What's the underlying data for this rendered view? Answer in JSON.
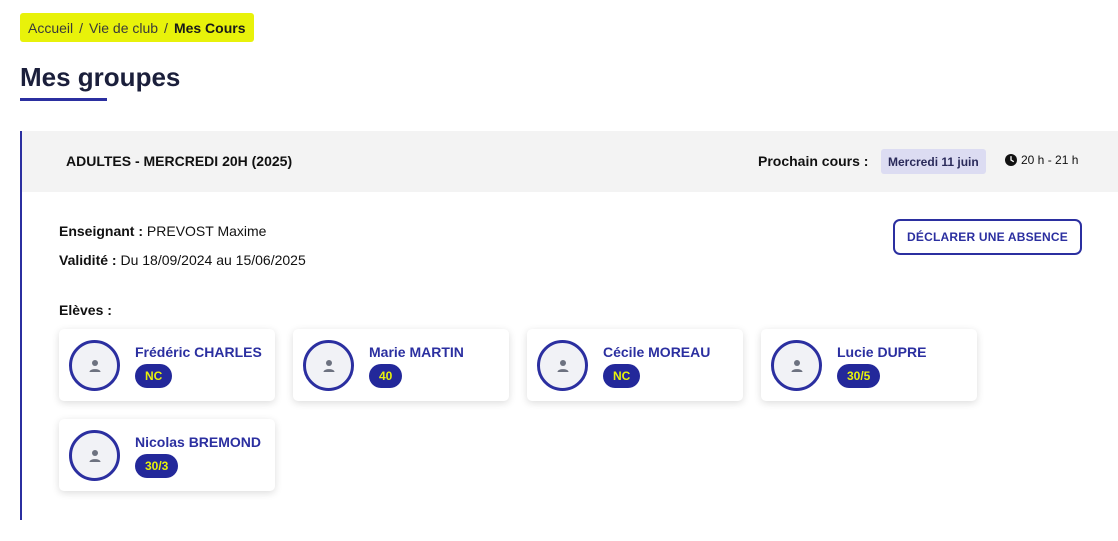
{
  "breadcrumb": {
    "items": [
      "Accueil",
      "Vie de club",
      "Mes Cours"
    ],
    "separator": "/"
  },
  "page": {
    "title": "Mes groupes"
  },
  "group": {
    "name": "ADULTES - MERCREDI 20H (2025)",
    "next_course_label": "Prochain cours :",
    "next_course_date": "Mercredi 11 juin",
    "next_course_time": "20 h - 21 h",
    "teacher_label": "Enseignant :",
    "teacher_value": " PREVOST Maxime",
    "validity_label": "Validité :",
    "validity_value": " Du 18/09/2024 au 15/06/2025",
    "absence_button": "DÉCLARER UNE ABSENCE",
    "students_label": "Elèves :",
    "students": [
      {
        "name": "Frédéric CHARLES",
        "level": "NC"
      },
      {
        "name": "Marie MARTIN",
        "level": "40"
      },
      {
        "name": "Cécile MOREAU",
        "level": "NC"
      },
      {
        "name": "Lucie DUPRE",
        "level": "30/5"
      },
      {
        "name": "Nicolas BREMOND",
        "level": "30/3"
      }
    ]
  },
  "colors": {
    "accent": "#2b2fa0",
    "highlight": "#e8f20a",
    "header_bg": "#f3f3f3",
    "date_badge_bg": "#dcdcf2"
  },
  "icons": {
    "avatar": "person-icon",
    "time": "clock-icon"
  }
}
